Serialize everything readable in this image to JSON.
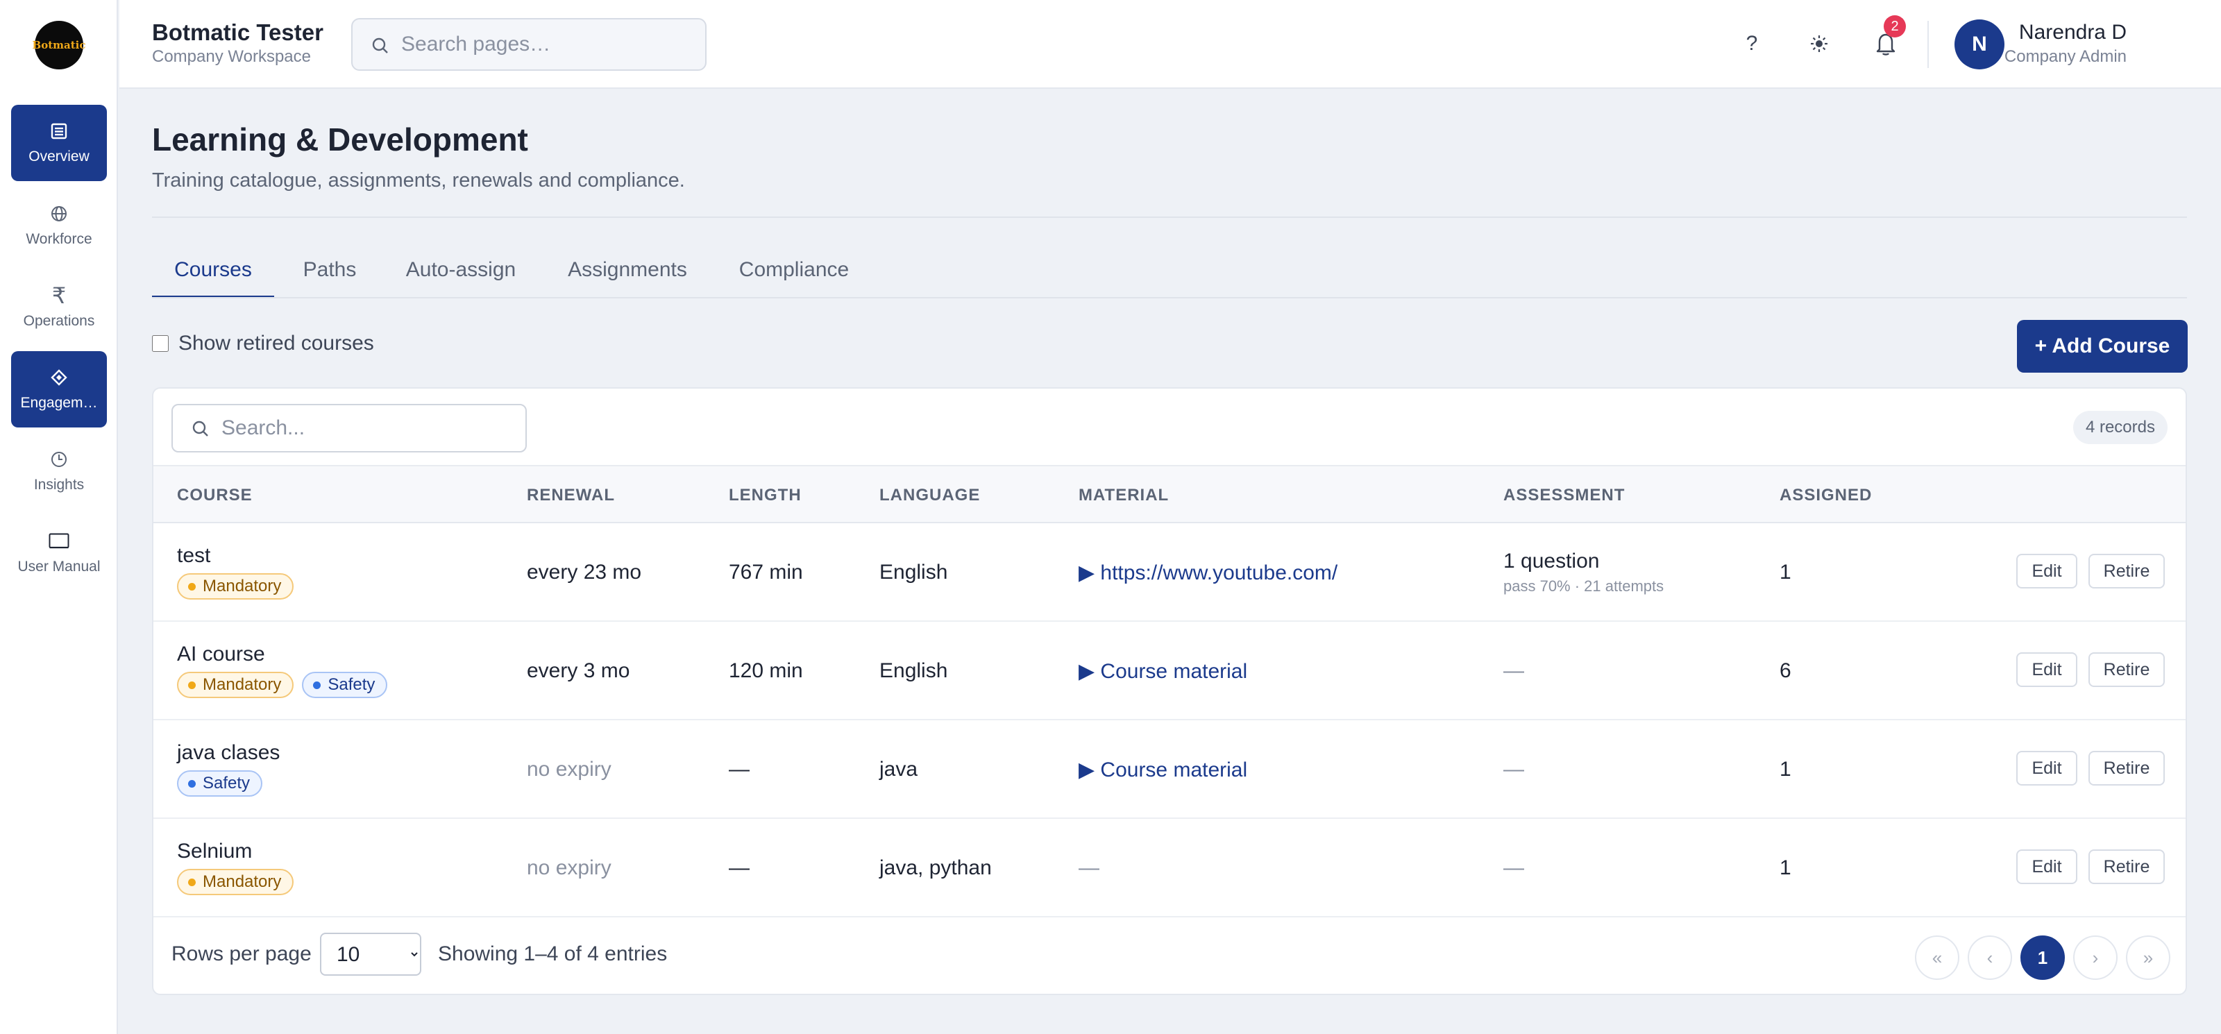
{
  "sidebar": {
    "logo_text": "Botmatic",
    "items": [
      {
        "label": "Overview",
        "icon": "list-icon",
        "active": true
      },
      {
        "label": "Workforce",
        "icon": "globe-icon",
        "active": false
      },
      {
        "label": "Operations",
        "icon": "rupee-icon",
        "active": false
      },
      {
        "label": "Engagem…",
        "icon": "diamond-icon",
        "active": true
      },
      {
        "label": "Insights",
        "icon": "clock-icon",
        "active": false
      },
      {
        "label": "User Manual",
        "icon": "book-icon",
        "active": false
      }
    ]
  },
  "topbar": {
    "workspace_title": "Botmatic Tester",
    "workspace_subtitle": "Company Workspace",
    "search_placeholder": "Search pages…",
    "notification_count": "2",
    "user_initial": "N",
    "user_name": "Narendra D",
    "user_role": "Company Admin"
  },
  "page": {
    "title": "Learning & Development",
    "subtitle": "Training catalogue, assignments, renewals and compliance."
  },
  "tabs": [
    {
      "label": "Courses",
      "active": true
    },
    {
      "label": "Paths",
      "active": false
    },
    {
      "label": "Auto-assign",
      "active": false
    },
    {
      "label": "Assignments",
      "active": false
    },
    {
      "label": "Compliance",
      "active": false
    }
  ],
  "toolbar": {
    "show_retired_label": "Show retired courses",
    "add_course_label": "+ Add Course"
  },
  "table": {
    "search_placeholder": "Search...",
    "records_badge": "4 records",
    "columns": [
      "COURSE",
      "RENEWAL",
      "LENGTH",
      "LANGUAGE",
      "MATERIAL",
      "ASSESSMENT",
      "ASSIGNED"
    ],
    "rows": [
      {
        "course": "test",
        "tags": [
          {
            "label": "Mandatory",
            "kind": "mandatory"
          }
        ],
        "renewal": "every 23 mo",
        "length": "767 min",
        "language": "English",
        "material": "▶ https://www.youtube.com/",
        "assessment": "1 question",
        "assessment_sub": "pass 70% · 21 attempts",
        "assigned": "1",
        "edit_label": "Edit",
        "retire_label": "Retire"
      },
      {
        "course": "AI course",
        "tags": [
          {
            "label": "Mandatory",
            "kind": "mandatory"
          },
          {
            "label": "Safety",
            "kind": "safety"
          }
        ],
        "renewal": "every 3 mo",
        "length": "120 min",
        "language": "English",
        "material": "▶ Course material",
        "assessment": "—",
        "assessment_sub": "",
        "assigned": "6",
        "edit_label": "Edit",
        "retire_label": "Retire"
      },
      {
        "course": "java clases",
        "tags": [
          {
            "label": "Safety",
            "kind": "safety"
          }
        ],
        "renewal": "no expiry",
        "length": "—",
        "language": "java",
        "material": "▶ Course material",
        "assessment": "—",
        "assessment_sub": "",
        "assigned": "1",
        "edit_label": "Edit",
        "retire_label": "Retire"
      },
      {
        "course": "Selnium",
        "tags": [
          {
            "label": "Mandatory",
            "kind": "mandatory"
          }
        ],
        "renewal": "no expiry",
        "length": "—",
        "language": "java, pythan",
        "material": "—",
        "assessment": "—",
        "assessment_sub": "",
        "assigned": "1",
        "edit_label": "Edit",
        "retire_label": "Retire"
      }
    ]
  },
  "footer": {
    "rows_per_page_label": "Rows per page",
    "rows_per_page_value": "10",
    "showing_text": "Showing 1–4 of 4 entries",
    "pagination": {
      "first": "«",
      "prev": "‹",
      "current": "1",
      "next": "›",
      "last": "»"
    }
  },
  "colors": {
    "primary": "#1b3a8c",
    "mandatory": "#f0a818",
    "safety": "#2f6fe0",
    "badge": "#e63957"
  }
}
